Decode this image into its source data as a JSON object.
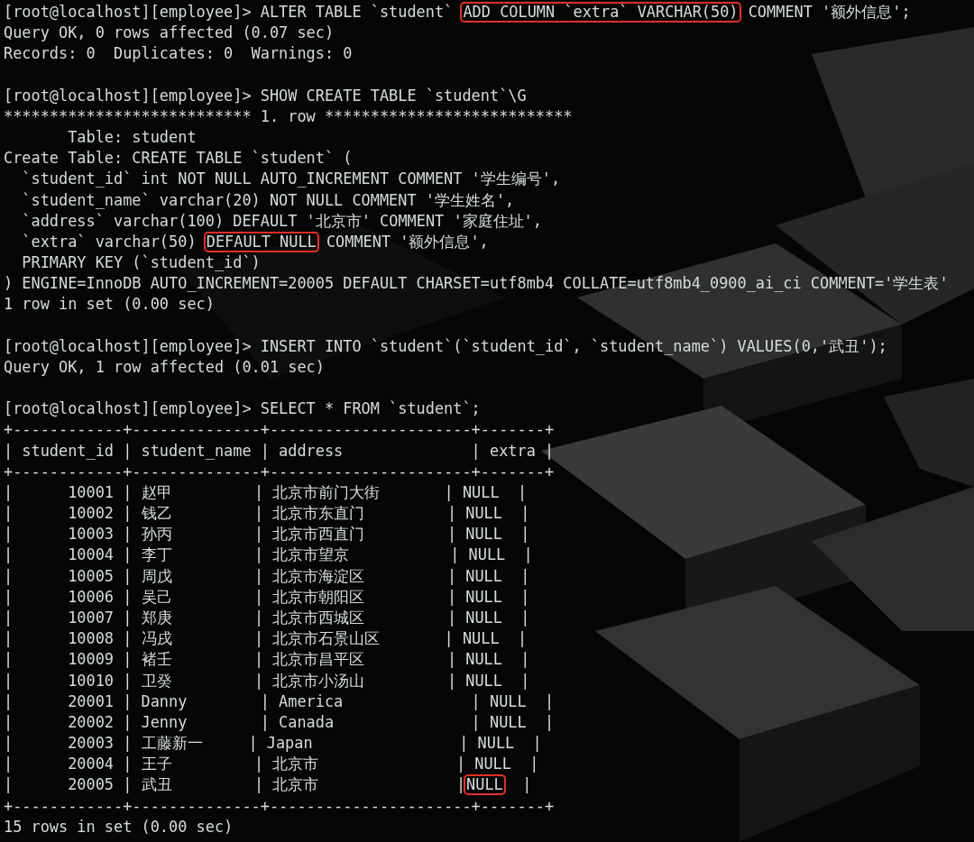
{
  "terminal": {
    "blocks": [
      {
        "lines": [
          {
            "segments": [
              {
                "text": "[root@localhost][employee]> ALTER TABLE `student` ",
                "boxed": false
              },
              {
                "text": "ADD COLUMN `extra` VARCHAR(50)",
                "boxed": true
              },
              {
                "text": " COMMENT '额外信息';",
                "boxed": false
              }
            ]
          },
          {
            "text": "Query OK, 0 rows affected (0.07 sec)"
          },
          {
            "text": "Records: 0  Duplicates: 0  Warnings: 0"
          }
        ]
      },
      {
        "lines": [
          {
            "text": "[root@localhost][employee]> SHOW CREATE TABLE `student`\\G"
          },
          {
            "text": "*************************** 1. row ***************************"
          },
          {
            "text": "       Table: student"
          },
          {
            "text": "Create Table: CREATE TABLE `student` ("
          },
          {
            "text": "  `student_id` int NOT NULL AUTO_INCREMENT COMMENT '学生编号',"
          },
          {
            "text": "  `student_name` varchar(20) NOT NULL COMMENT '学生姓名',"
          },
          {
            "text": "  `address` varchar(100) DEFAULT '北京市' COMMENT '家庭住址',"
          },
          {
            "segments": [
              {
                "text": "  `extra` varchar(50) ",
                "boxed": false
              },
              {
                "text": "DEFAULT NULL",
                "boxed": true
              },
              {
                "text": " COMMENT '额外信息',",
                "boxed": false
              }
            ]
          },
          {
            "text": "  PRIMARY KEY (`student_id`)"
          },
          {
            "text": ") ENGINE=InnoDB AUTO_INCREMENT=20005 DEFAULT CHARSET=utf8mb4 COLLATE=utf8mb4_0900_ai_ci COMMENT='学生表'"
          },
          {
            "text": "1 row in set (0.00 sec)"
          }
        ]
      },
      {
        "lines": [
          {
            "text": "[root@localhost][employee]> INSERT INTO `student`(`student_id`, `student_name`) VALUES(0,'武丑');"
          },
          {
            "text": "Query OK, 1 row affected (0.01 sec)"
          }
        ]
      },
      {
        "lines": [
          {
            "text": "[root@localhost][employee]> SELECT * FROM `student`;"
          },
          {
            "text": "+------------+--------------+----------------------+-------+"
          },
          {
            "text": "| student_id | student_name | address              | extra |"
          },
          {
            "text": "+------------+--------------+----------------------+-------+"
          },
          {
            "text": "|      10001 | 赵甲         | 北京市前门大街       | NULL  |"
          },
          {
            "text": "|      10002 | 钱乙         | 北京市东直门         | NULL  |"
          },
          {
            "text": "|      10003 | 孙丙         | 北京市西直门         | NULL  |"
          },
          {
            "text": "|      10004 | 李丁         | 北京市望京           | NULL  |"
          },
          {
            "text": "|      10005 | 周戊         | 北京市海淀区         | NULL  |"
          },
          {
            "text": "|      10006 | 吴己         | 北京市朝阳区         | NULL  |"
          },
          {
            "text": "|      10007 | 郑庚         | 北京市西城区         | NULL  |"
          },
          {
            "text": "|      10008 | 冯戌         | 北京市石景山区       | NULL  |"
          },
          {
            "text": "|      10009 | 褚壬         | 北京市昌平区         | NULL  |"
          },
          {
            "text": "|      10010 | 卫癸         | 北京市小汤山         | NULL  |"
          },
          {
            "text": "|      20001 | Danny        | America              | NULL  |"
          },
          {
            "text": "|      20002 | Jenny        | Canada               | NULL  |"
          },
          {
            "text": "|      20003 | 工藤新一     | Japan                | NULL  |"
          },
          {
            "text": "|      20004 | 王子         | 北京市               | NULL  |"
          },
          {
            "segments": [
              {
                "text": "|      20005 | 武丑         | 北京市               |",
                "boxed": false
              },
              {
                "text": "NULL",
                "boxed": true
              },
              {
                "text": "  |",
                "boxed": false
              }
            ]
          },
          {
            "text": "+------------+--------------+----------------------+-------+"
          },
          {
            "text": "15 rows in set (0.00 sec)"
          }
        ]
      }
    ]
  }
}
